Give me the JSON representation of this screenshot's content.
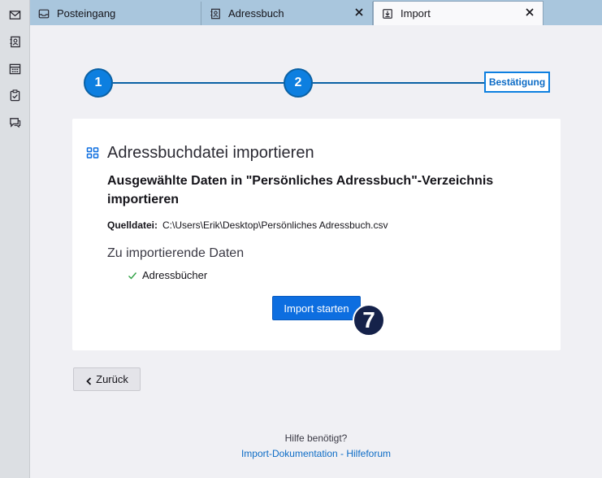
{
  "tabs": [
    {
      "label": "Posteingang",
      "icon": "inbox-icon",
      "active": false,
      "closable": false
    },
    {
      "label": "Adressbuch",
      "icon": "addressbook-icon",
      "active": false,
      "closable": true
    },
    {
      "label": "Import",
      "icon": "import-icon",
      "active": true,
      "closable": true
    }
  ],
  "spaces": [
    "mail-icon",
    "addressbook-icon",
    "calendar-icon",
    "tasks-icon",
    "chat-icon"
  ],
  "stepper": {
    "step1": "1",
    "step2": "2",
    "final": "Bestätigung"
  },
  "card": {
    "title": "Adressbuchdatei importieren",
    "subtitle": "Ausgewählte Daten in \"Persönliches Adressbuch\"-Verzeichnis importieren",
    "source_label": "Quelldatei:",
    "source_value": "C:\\Users\\Erik\\Desktop\\Persönliches Adressbuch.csv",
    "data_heading": "Zu importierende Daten",
    "data_items": [
      "Adressbücher"
    ],
    "start_button": "Import starten",
    "badge": "7"
  },
  "back_button": "Zurück",
  "help": {
    "question": "Hilfe benötigt?",
    "link_docs": "Import-Dokumentation",
    "separator": " - ",
    "link_forum": "Hilfeforum"
  },
  "colors": {
    "accent": "#0d6ee0",
    "tabbar": "#a9c6dd",
    "badge": "#15224a"
  }
}
